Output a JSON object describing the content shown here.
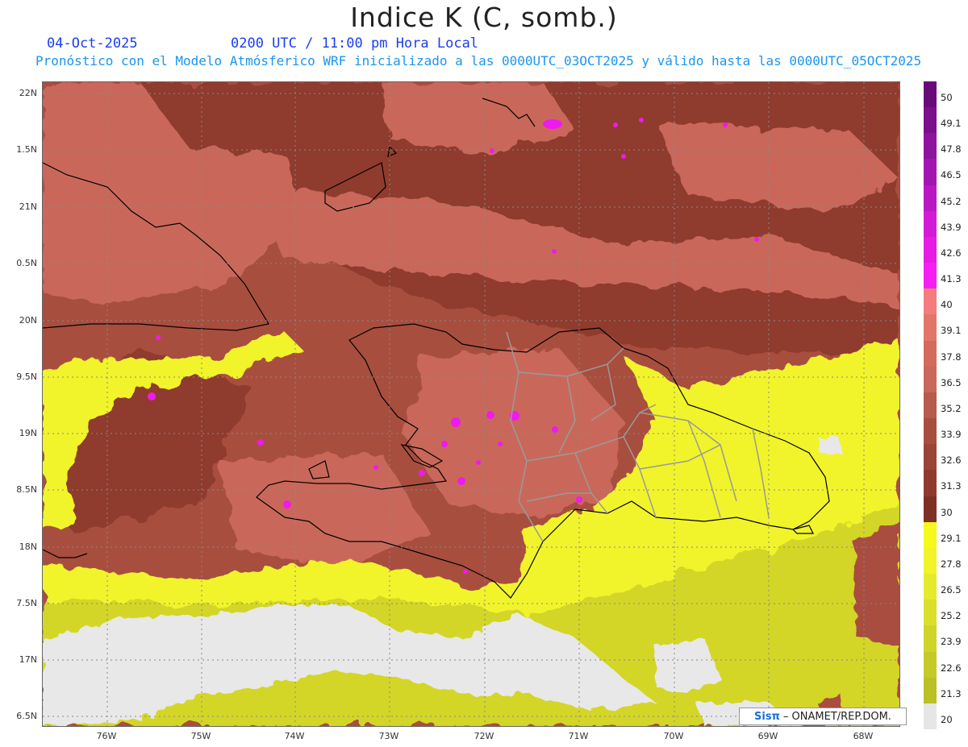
{
  "header": {
    "title": "Indice K (C, somb.)",
    "date": "04-Oct-2025",
    "time": "0200 UTC / 11:00 pm Hora Local",
    "description": "Pronóstico con el Modelo Atmósferico WRF inicializado a las 0000UTC_03OCT2025 y válido hasta las  0000UTC_05OCT2025"
  },
  "map": {
    "lat_labels": [
      "22N",
      "1.5N",
      "21N",
      "0.5N",
      "20N",
      "9.5N",
      "19N",
      "8.5N",
      "18N",
      "7.5N",
      "17N",
      "6.5N"
    ],
    "lon_labels": [
      "76W",
      "75W",
      "74W",
      "73W",
      "72W",
      "71W",
      "70W",
      "69W",
      "68W"
    ],
    "colors": {
      "ocean_dry": "#e8e8e8",
      "yellow_band": "#f1f42a",
      "olive_band": "#d3d628",
      "dark_red": "#8f3a2d",
      "mid_red": "#a84e3f",
      "light_red": "#c9675a",
      "magenta": "#f019f0",
      "coastline": "#000000",
      "province_border": "#9a9a9a"
    }
  },
  "colorbar": {
    "labels": [
      "50",
      "49.1",
      "47.8",
      "46.5",
      "45.2",
      "43.9",
      "42.6",
      "41.3",
      "40",
      "39.1",
      "37.8",
      "36.5",
      "35.2",
      "33.9",
      "32.6",
      "31.3",
      "30",
      "29.1",
      "27.8",
      "26.5",
      "25.2",
      "23.9",
      "22.6",
      "21.3",
      "20"
    ],
    "colors": [
      "#6a0a7a",
      "#7c0f8c",
      "#8e139e",
      "#a316b1",
      "#ba18c4",
      "#d31ad7",
      "#e61be6",
      "#f51ff5",
      "#f47c7c",
      "#e27668",
      "#d46a5c",
      "#c9675a",
      "#b85a4c",
      "#a84e3f",
      "#9a4536",
      "#8f3a2d",
      "#7f3024",
      "#f6f91c",
      "#f1f42a",
      "#e6ea2c",
      "#dadf2b",
      "#cfd42a",
      "#c5c929",
      "#bcc027",
      "#e6e6e6"
    ]
  },
  "credit": {
    "brand": "Sis",
    "symbol": "π",
    "text": "– ONAMET/REP.DOM."
  }
}
